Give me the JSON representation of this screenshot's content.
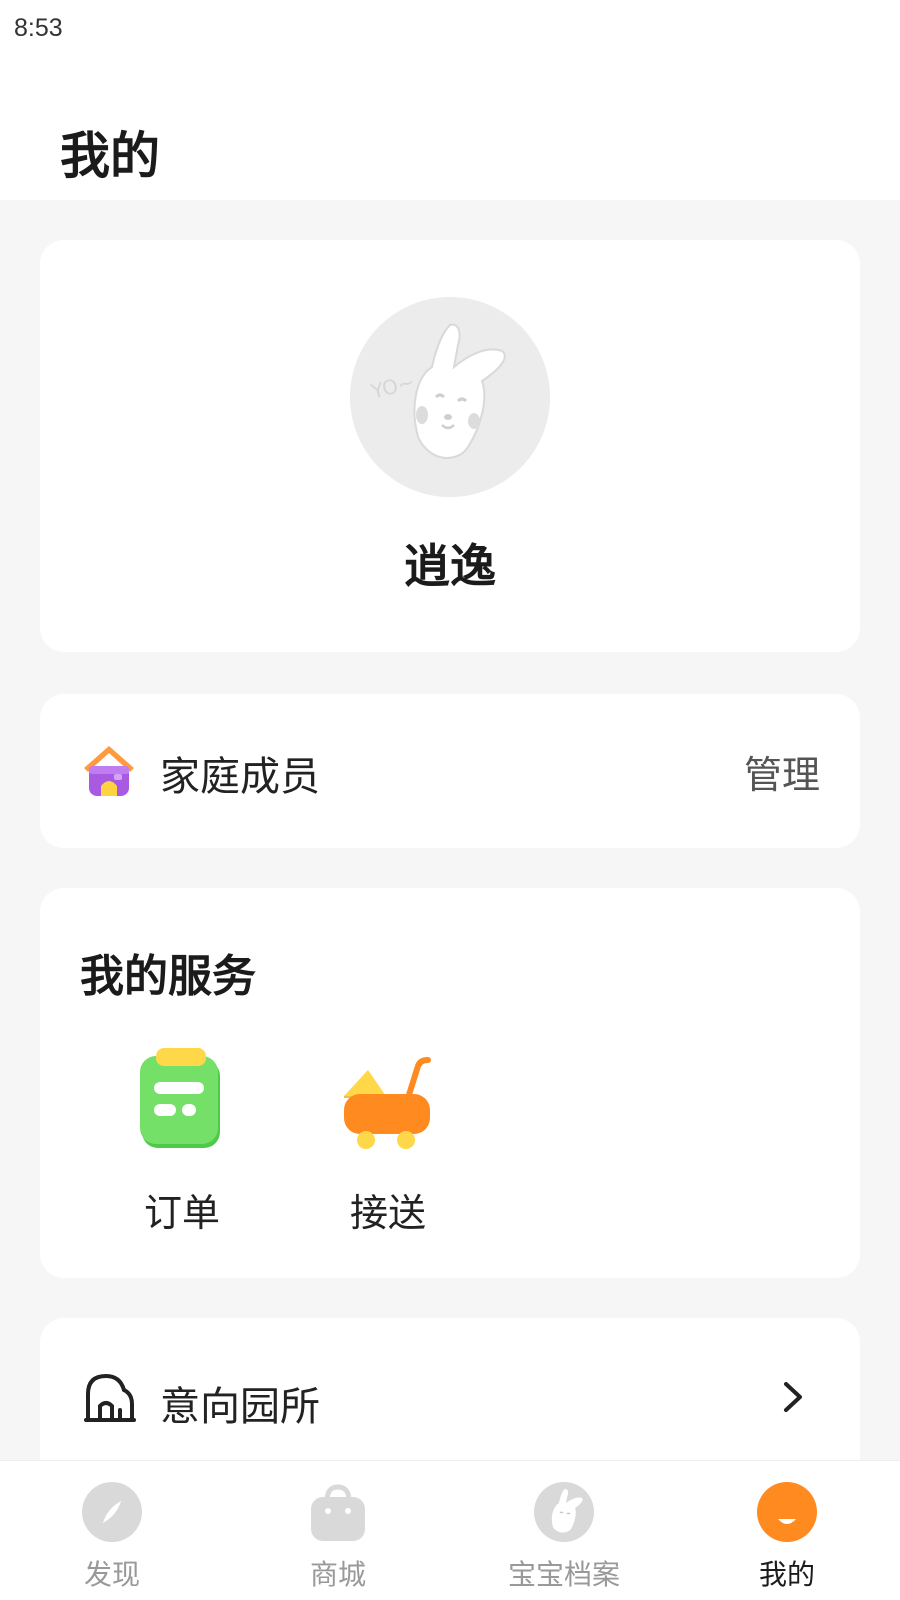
{
  "status_bar": {
    "time": "8:53"
  },
  "header": {
    "title": "我的"
  },
  "profile": {
    "name": "逍逸",
    "avatar_icon": "bunny-avatar-icon"
  },
  "family": {
    "label": "家庭成员",
    "action": "管理",
    "icon": "house-icon"
  },
  "services": {
    "title": "我的服务",
    "items": [
      {
        "label": "订单",
        "icon": "order-clipboard-icon"
      },
      {
        "label": "接送",
        "icon": "stroller-icon"
      }
    ]
  },
  "kindergarten": {
    "label": "意向园所",
    "icon": "kindergarten-icon"
  },
  "tabs": [
    {
      "label": "发现",
      "icon": "compass-icon",
      "active": false
    },
    {
      "label": "商城",
      "icon": "shopping-bag-icon",
      "active": false
    },
    {
      "label": "宝宝档案",
      "icon": "bunny-avatar-icon",
      "active": false
    },
    {
      "label": "我的",
      "icon": "smile-face-icon",
      "active": true
    }
  ],
  "colors": {
    "accent": "#ff8a1f",
    "background": "#f6f6f6",
    "inactive_tab": "#999999"
  }
}
